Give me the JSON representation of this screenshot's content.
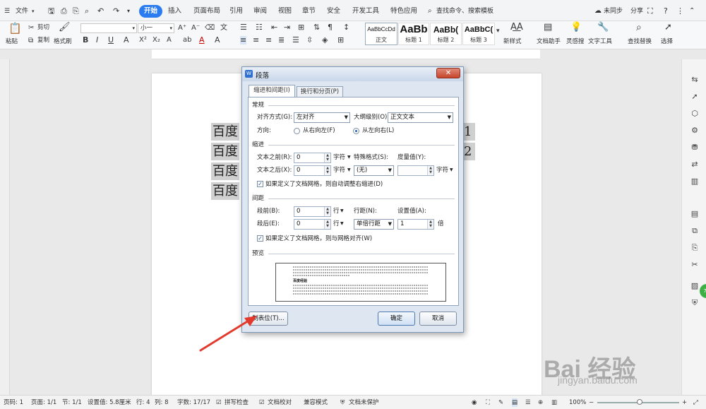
{
  "topbar": {
    "file_menu": "文件",
    "tabs": [
      "开始",
      "插入",
      "页面布局",
      "引用",
      "审阅",
      "视图",
      "章节",
      "安全",
      "开发工具",
      "特色应用"
    ],
    "active_tab": "开始",
    "search_placeholder": "查找命令、搜索模板",
    "sync_label": "未同步",
    "share_label": "分享"
  },
  "ribbon": {
    "paste": "粘贴",
    "cut": "剪切",
    "copy": "复制",
    "format_painter": "格式刷",
    "font_name": "",
    "font_size": "小一",
    "styles": [
      {
        "sample": "AaBbCcDd",
        "name": "正文"
      },
      {
        "sample": "AaBb",
        "name": "标题 1"
      },
      {
        "sample": "AaBb(",
        "name": "标题 2"
      },
      {
        "sample": "AaBbC(",
        "name": "标题 3"
      }
    ],
    "new_style": "新样式",
    "doc_assistant": "文档助手",
    "inspiration": "灵感搜",
    "text_tools": "文字工具",
    "find_replace": "查找替换",
    "select": "选择"
  },
  "document": {
    "lines": [
      "百度",
      "百度",
      "百度",
      "百度"
    ],
    "right_digits": [
      "1",
      "2"
    ]
  },
  "dialog": {
    "title": "段落",
    "tabs": [
      "缩进和间距(I)",
      "换行和分页(P)"
    ],
    "general": {
      "section": "常规",
      "align_label": "对齐方式(G):",
      "align_value": "左对齐",
      "outline_label": "大纲级别(O):",
      "outline_value": "正文文本",
      "direction_label": "方向:",
      "rtl_label": "从右向左(F)",
      "ltr_label": "从左向右(L)"
    },
    "indent": {
      "section": "缩进",
      "before_label": "文本之前(R):",
      "before_value": "0",
      "before_unit": "字符",
      "special_label": "特殊格式(S):",
      "special_value": "(无)",
      "measure_label": "度量值(Y):",
      "measure_value": "",
      "measure_unit": "字符",
      "after_label": "文本之后(X):",
      "after_value": "0",
      "after_unit": "字符",
      "grid_check": "如果定义了文档网格，则自动调整右缩进(D)"
    },
    "spacing": {
      "section": "间距",
      "before_label": "段前(B):",
      "before_value": "0",
      "before_unit": "行",
      "line_spacing_label": "行距(N):",
      "line_spacing_value": "单倍行距",
      "setting_label": "设置值(A):",
      "setting_value": "1",
      "setting_unit": "倍",
      "after_label": "段后(E):",
      "after_value": "0",
      "after_unit": "行",
      "grid_check": "如果定义了文档网格，则与网格对齐(W)"
    },
    "preview": {
      "section": "预览",
      "sample_text": "百度经验"
    },
    "tabs_button": "制表位(T)...",
    "ok_button": "确定",
    "cancel_button": "取消"
  },
  "statusbar": {
    "page_number": "页码: 1",
    "page": "页面: 1/1",
    "section": "节: 1/1",
    "position": "设置值: 5.8厘米",
    "row": "行: 4",
    "column": "列: 8",
    "word_count": "字数: 17/17",
    "spellcheck": "拼写检查",
    "doc_proof": "文档校对",
    "compat_mode": "兼容模式",
    "protection": "文档未保护",
    "zoom": "100%"
  },
  "watermark": {
    "logo": "Bai 经验",
    "url": "jingyan.baidu.com"
  }
}
